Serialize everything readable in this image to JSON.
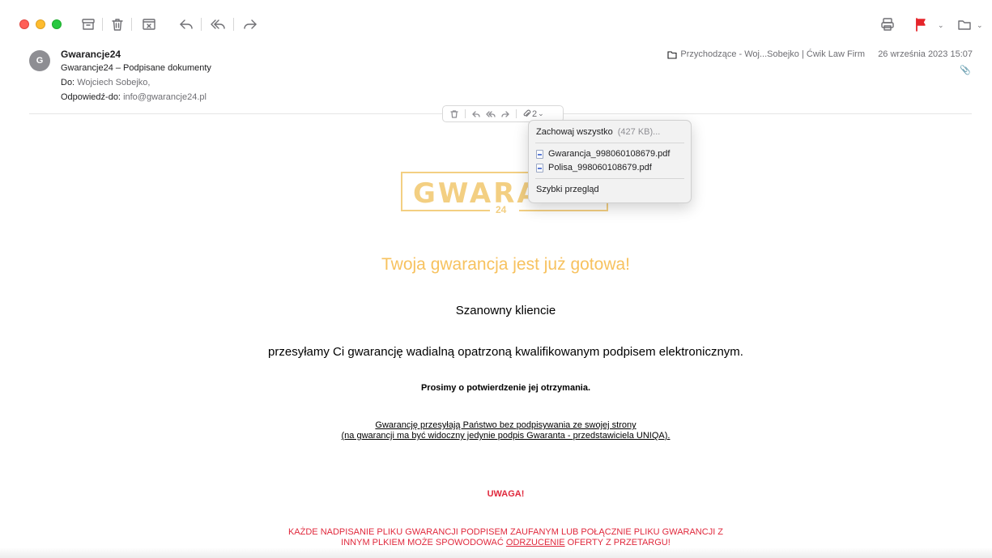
{
  "toolbar": {
    "icons": [
      "archive-icon",
      "trash-icon",
      "junk-icon",
      "reply-icon",
      "reply-all-icon",
      "forward-icon",
      "print-icon",
      "flag-icon",
      "move-to-folder-icon"
    ],
    "flag_color": "#e5242a"
  },
  "message": {
    "avatar_initial": "G",
    "sender": "Gwarancje24",
    "subject": "Gwarancje24 – Podpisane dokumenty",
    "to_label": "Do:",
    "to_value": "Wojciech Sobejko,",
    "reply_to_label": "Odpowiedź-do:",
    "reply_to_value": "info@gwarancje24.pl",
    "mailbox": "Przychodzące - Woj...Sobejko | Ćwik Law Firm",
    "date": "26 września 2023 15:07"
  },
  "attachments": {
    "count": "2",
    "menu": {
      "save_all_label": "Zachowaj wszystko",
      "save_all_size": "(427 KB)...",
      "files": [
        "Gwarancja_998060108679.pdf",
        "Polisa_998060108679.pdf"
      ],
      "quick_look": "Szybki przegląd"
    }
  },
  "body": {
    "logo_text": "GWARAI",
    "logo_sub": "24",
    "headline": "Twoja gwarancja jest już gotowa!",
    "greeting": "Szanowny kliencie",
    "line1": "przesyłamy Ci gwarancję wadialną opatrzoną kwalifikowanym podpisem elektronicznym.",
    "line2": "Prosimy o potwierdzenie jej otrzymania.",
    "note_line1": "Gwarancję przesyłają Państwo bez podpisywania ze swojej strony",
    "note_line2": "(na gwarancji ma być widoczny jedynie podpis Gwaranta - przedstawiciela UNIQA).",
    "warning_title": "UWAGA!",
    "warning_line1": "KAŻDE NADPISANIE PLIKU GWARANCJI PODPISEM ZAUFANYM LUB POŁĄCZNIE PLIKU GWARANCJI Z",
    "warning_line2_a": "INNYM PLKIEM MOŻE SPOWODOWAĆ ",
    "warning_line2_b": "ODRZUCENIE",
    "warning_line2_c": " OFERTY Z PRZETARGU!",
    "colors": {
      "accent_gold": "#f7c25f",
      "warning_red": "#e0283c"
    }
  }
}
